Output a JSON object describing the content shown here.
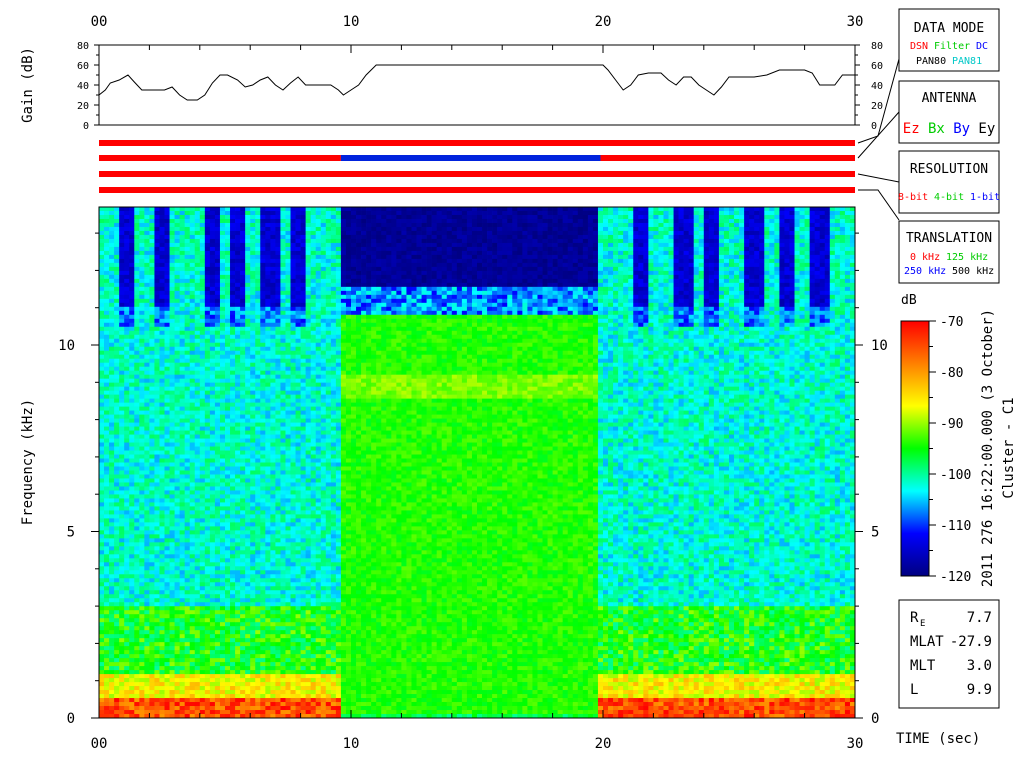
{
  "chart_data": [
    {
      "type": "line",
      "ylabel": "Gain (dB)",
      "xlim": [
        0,
        30
      ],
      "ylim": [
        0,
        80
      ],
      "x_ticks": [
        {
          "value": 0,
          "label": "00"
        },
        {
          "value": 10,
          "label": "10"
        },
        {
          "value": 20,
          "label": "20"
        },
        {
          "value": 30,
          "label": "30"
        }
      ],
      "y_ticks": [
        "0",
        "20",
        "40",
        "60",
        "80"
      ],
      "series": [
        {
          "x": [
            0.0,
            0.25,
            0.45,
            0.8,
            1.15,
            1.4,
            1.7,
            2.0,
            2.3,
            2.6,
            2.9,
            3.2,
            3.5,
            3.9,
            4.2,
            4.5,
            4.8,
            5.1,
            5.5,
            5.8,
            6.1,
            6.4,
            6.7,
            7.0,
            7.3,
            7.6,
            7.9,
            8.2,
            8.5,
            8.9,
            9.2,
            9.5,
            9.7,
            10.0,
            10.3,
            10.6,
            11.0,
            12.0,
            14.0,
            16.0,
            18.0,
            19.5,
            20.0,
            20.2,
            20.5,
            20.8,
            21.1,
            21.4,
            21.8,
            22.3,
            22.6,
            22.9,
            23.2,
            23.5,
            23.8,
            24.1,
            24.4,
            24.7,
            25.0,
            25.5,
            26.0,
            26.5,
            27.0,
            27.5,
            28.0,
            28.3,
            28.6,
            28.9,
            29.2,
            29.5,
            30.0
          ],
          "y": [
            30,
            35,
            42,
            45,
            50,
            43,
            35,
            35,
            35,
            35,
            38,
            30,
            25,
            25,
            30,
            42,
            50,
            50,
            45,
            38,
            40,
            45,
            48,
            40,
            35,
            42,
            48,
            40,
            40,
            40,
            40,
            35,
            30,
            35,
            40,
            50,
            60,
            60,
            60,
            60,
            60,
            60,
            60,
            55,
            45,
            35,
            40,
            50,
            52,
            52,
            45,
            40,
            48,
            48,
            40,
            35,
            30,
            38,
            48,
            48,
            48,
            50,
            55,
            55,
            55,
            52,
            40,
            40,
            40,
            50,
            50
          ]
        }
      ]
    },
    {
      "type": "heatmap",
      "xlabel": "TIME (sec)",
      "ylabel": "Frequency (kHz)",
      "xlim": [
        0,
        30
      ],
      "ylim": [
        0,
        13.7
      ],
      "x_ticks": [
        {
          "value": 0,
          "label": "00"
        },
        {
          "value": 10,
          "label": "10"
        },
        {
          "value": 20,
          "label": "20"
        },
        {
          "value": 30,
          "label": "30"
        }
      ],
      "y_ticks": [
        "0",
        "5",
        "10"
      ],
      "colorbar": {
        "label": "dB",
        "min": -120,
        "max": -70,
        "ticks": [
          "-70",
          "-80",
          "-90",
          "-100",
          "-110",
          "-120"
        ]
      },
      "segments": [
        {
          "x": [
            0,
            9.6
          ],
          "mode": "ambient",
          "upper_band_level_db": -108,
          "lower_level_db": -100
        },
        {
          "x": [
            9.6,
            19.9
          ],
          "mode": "filtered",
          "upper_band_level_db": -120,
          "lower_level_db": -96
        },
        {
          "x": [
            19.9,
            30
          ],
          "mode": "ambient",
          "upper_band_level_db": -108,
          "lower_level_db": -100
        }
      ]
    }
  ],
  "status_bars": [
    {
      "segments": [
        {
          "x": [
            0,
            30
          ],
          "color": "#ff0000"
        }
      ]
    },
    {
      "segments": [
        {
          "x": [
            0,
            9.6
          ],
          "color": "#ff0000"
        },
        {
          "x": [
            9.6,
            19.9
          ],
          "color": "#0022dd"
        },
        {
          "x": [
            19.9,
            30
          ],
          "color": "#ff0000"
        }
      ]
    },
    {
      "segments": [
        {
          "x": [
            0,
            30
          ],
          "color": "#ff0000"
        }
      ]
    },
    {
      "segments": [
        {
          "x": [
            0,
            30
          ],
          "color": "#ff0000"
        }
      ]
    }
  ],
  "legend_boxes": {
    "data_mode": {
      "title": "DATA MODE",
      "line1": [
        {
          "text": "DSN",
          "color": "#ff0000"
        },
        {
          "text": "Filter",
          "color": "#00cc00"
        },
        {
          "text": "DC",
          "color": "#0000ff"
        }
      ],
      "line2": [
        {
          "text": "PAN80",
          "color": "#000000"
        },
        {
          "text": "PAN81",
          "color": "#00c8c8"
        }
      ]
    },
    "antenna": {
      "title": "ANTENNA",
      "items": [
        {
          "text": "Ez",
          "color": "#ff0000"
        },
        {
          "text": "Bx",
          "color": "#00cc00"
        },
        {
          "text": "By",
          "color": "#0000ff"
        },
        {
          "text": "Ey",
          "color": "#000000"
        }
      ]
    },
    "resolution": {
      "title": "RESOLUTION",
      "items": [
        {
          "text": "8-bit",
          "color": "#ff0000"
        },
        {
          "text": "4-bit",
          "color": "#00cc00"
        },
        {
          "text": "1-bit",
          "color": "#0000ff"
        }
      ]
    },
    "translation": {
      "title": "TRANSLATION",
      "line1": [
        {
          "text": "0 kHz",
          "color": "#ff0000"
        },
        {
          "text": "125 kHz",
          "color": "#00cc00"
        }
      ],
      "line2": [
        {
          "text": "250 kHz",
          "color": "#0000ff"
        },
        {
          "text": "500 kHz",
          "color": "#000000"
        }
      ]
    }
  },
  "colormap": [
    "#000080",
    "#0000ff",
    "#00ffff",
    "#00ff00",
    "#ffff00",
    "#ff8000",
    "#ff0000"
  ],
  "datetime_label": "2011 276 16:22:00.000 (3 October)",
  "spacecraft_label": "Cluster - C1",
  "orbit_params": [
    {
      "label_main": "R",
      "label_sub": "E",
      "value": "7.7"
    },
    {
      "label_main": "MLAT",
      "label_sub": "",
      "value": "-27.9"
    },
    {
      "label_main": "MLT",
      "label_sub": "",
      "value": "3.0"
    },
    {
      "label_main": "L",
      "label_sub": "",
      "value": "9.9"
    }
  ]
}
